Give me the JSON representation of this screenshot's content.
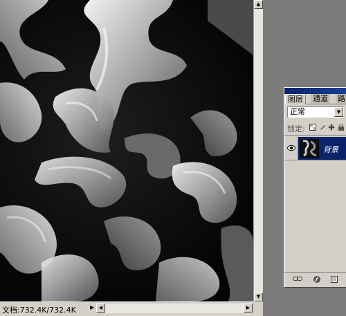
{
  "status_bar": {
    "doc_info": "文档:732.4K/732.4K",
    "menu_arrow": "▶",
    "scroll_left": "◀",
    "scroll_right": "▶"
  },
  "scrollbar": {
    "up": "▲",
    "down": "▼"
  },
  "layers_palette": {
    "tabs": [
      {
        "label": "图层"
      },
      {
        "label": "通道"
      },
      {
        "label": "路"
      }
    ],
    "blend_mode": "正常",
    "blend_arrow": "▼",
    "lock_label": "锁定:",
    "lock_icons": [
      "lock-transparent-icon",
      "lock-pixels-icon",
      "lock-position-icon"
    ],
    "layer": {
      "name": "背景",
      "visible": true,
      "selected": true
    },
    "bottom_icons": [
      "link-icon",
      "layer-style-icon",
      "new-layer-icon"
    ]
  },
  "colors": {
    "selection": "#0a246a",
    "window_face": "#d4d0c8",
    "workspace": "#7c7c7c"
  }
}
